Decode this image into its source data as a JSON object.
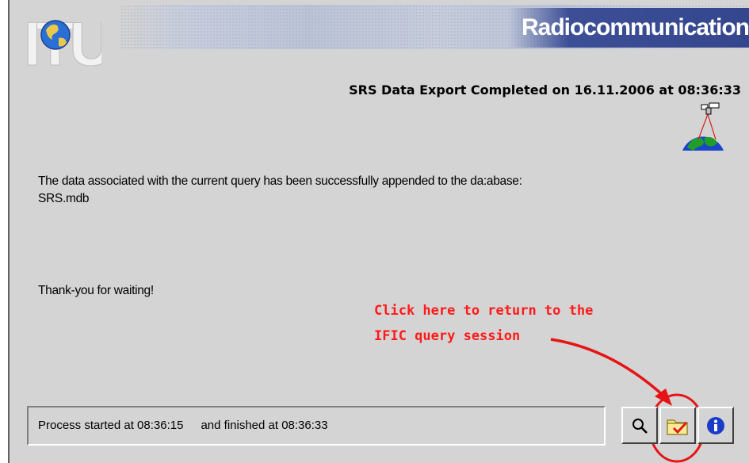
{
  "header": {
    "brand_title": "Radiocommunication",
    "logo_letters": "ITU",
    "export_title": "SRS Data Export Completed  on 16.11.2006  at 08:36:33"
  },
  "main": {
    "message_line1": "The data associated with the current query has been successfully appended to the da:abase:",
    "message_line2": "SRS.mdb",
    "thanks": "Thank-you for waiting!"
  },
  "annotation": {
    "line1": "Click here to return to the",
    "line2": "IFIC query session",
    "color": "#ff1a1a"
  },
  "status": {
    "started": "Process started at 08:36:15",
    "finished": "and finished at 08:36:33"
  },
  "buttons": {
    "search_icon": "magnifier-icon",
    "folder_icon": "folder-check-icon",
    "info_icon": "info-icon"
  },
  "colors": {
    "window_bg": "#d4d4d4",
    "brand_band": "#3c4e96",
    "annotation_red": "#ff1a1a",
    "info_blue": "#1a3cc8"
  }
}
